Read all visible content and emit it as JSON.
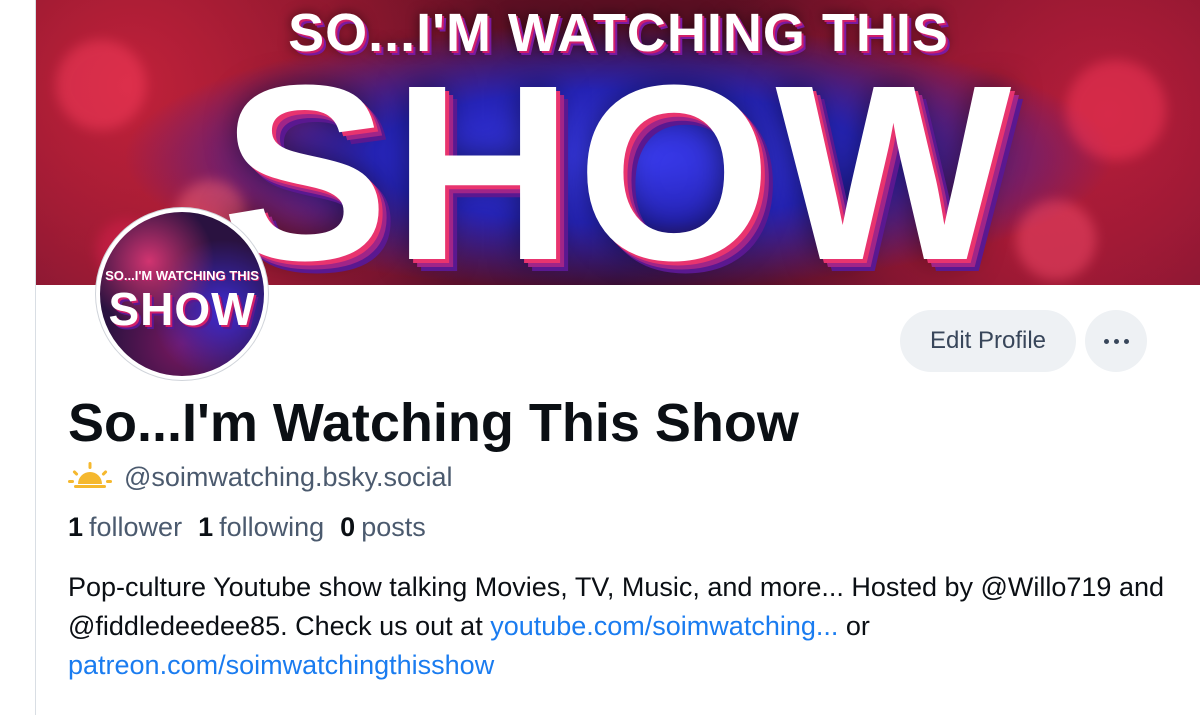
{
  "banner": {
    "line1": "SO...I'M WATCHING THIS",
    "line2": "SHOW"
  },
  "avatar": {
    "line1": "SO...I'M WATCHING THIS",
    "line2": "SHOW"
  },
  "actions": {
    "edit_label": "Edit Profile",
    "more_icon": "ellipsis-icon"
  },
  "profile": {
    "display_name": "So...I'm Watching This Show",
    "handle_icon": "sunrise-icon",
    "handle": "@soimwatching.bsky.social",
    "stats": {
      "followers_count": "1",
      "followers_label": "follower",
      "following_count": "1",
      "following_label": "following",
      "posts_count": "0",
      "posts_label": "posts"
    },
    "bio": {
      "text_1": "Pop-culture Youtube show talking Movies, TV, Music, and more... Hosted by @Willo719 and @fiddledeedee85. Check us out at ",
      "link_1": "youtube.com/soimwatching...",
      "text_2": " or ",
      "link_2": "patreon.com/soimwatchingthisshow"
    }
  },
  "colors": {
    "link": "#1a7cf0",
    "secondary_text": "#4b5a6e",
    "button_bg": "#eef1f4"
  }
}
